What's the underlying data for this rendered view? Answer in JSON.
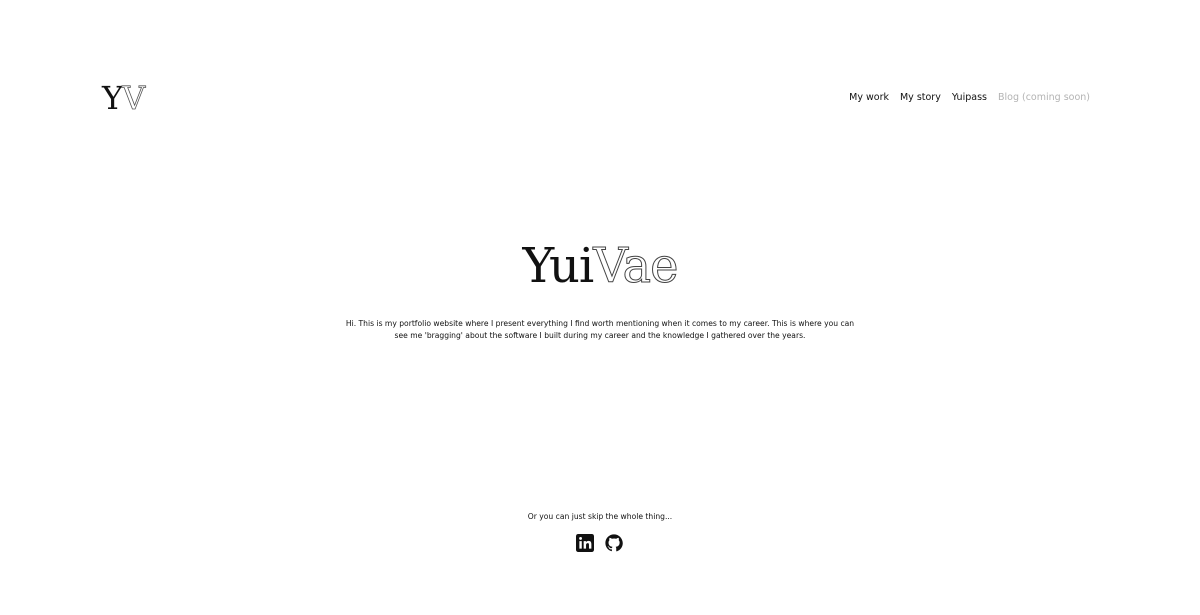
{
  "header": {
    "logo": {
      "solid": "Y",
      "outline": "V"
    },
    "nav": [
      {
        "label": "My work",
        "enabled": true
      },
      {
        "label": "My story",
        "enabled": true
      },
      {
        "label": "Yuipass",
        "enabled": true
      },
      {
        "label": "Blog (coming soon)",
        "enabled": false
      }
    ]
  },
  "hero": {
    "title_solid": "Yui",
    "title_outline": "Vae",
    "intro": "Hi. This is my portfolio website where I present everything I find worth mentioning when it comes to my career. This is where you can see me 'bragging' about the software I built during my career and the knowledge I gathered over the years."
  },
  "footer": {
    "skip_text": "Or you can just skip the whole thing...",
    "socials": [
      {
        "icon": "linkedin-icon"
      },
      {
        "icon": "github-icon"
      }
    ]
  },
  "colors": {
    "text": "#111111",
    "muted": "#b3b3b3",
    "background": "#ffffff"
  }
}
